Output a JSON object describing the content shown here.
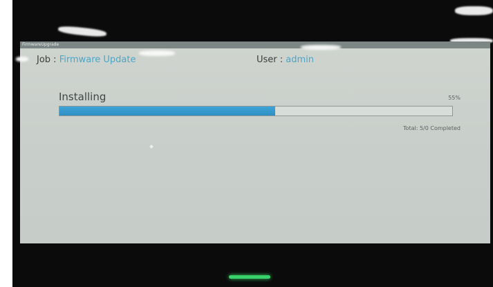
{
  "window": {
    "title": "FirmwareUpgrade"
  },
  "header": {
    "job_label": "Job : ",
    "job_value": "Firmware Update",
    "user_label": "User : ",
    "user_value": "admin"
  },
  "progress": {
    "status": "Installing",
    "percent_label": "55%",
    "percent": 55,
    "total_label": "Total: 5/0 Completed"
  },
  "colors": {
    "accent": "#4aa6c8",
    "progress_fill": "#3ea3d6",
    "indicator_light": "#39d36b"
  }
}
